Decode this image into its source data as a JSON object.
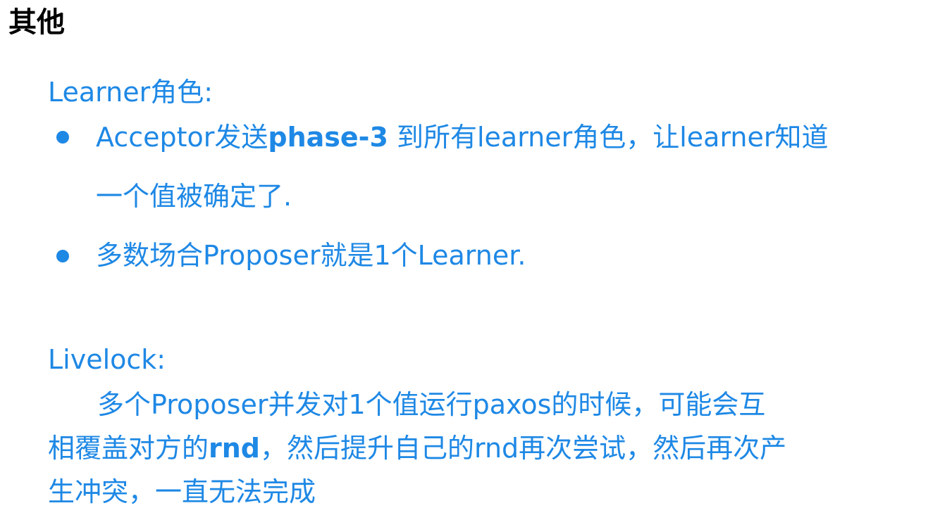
{
  "title": "其他",
  "learner_section": {
    "heading": "Learner角色:",
    "bullet1": {
      "line1_a": "Acceptor发送",
      "line1_b": "phase-3",
      "line1_c": " 到所有learner角色，让learner知道",
      "line2": "一个值被确定了."
    },
    "bullet2": {
      "line1": "多数场合Proposer就是1个Learner."
    }
  },
  "livelock_section": {
    "heading": "Livelock:",
    "line1": "多个Proposer并发对1个值运行paxos的时候，可能会互",
    "line2_a": "相覆盖对方的",
    "line2_b": "rnd",
    "line2_c": "，然后提升自己的rnd再次尝试，然后再次产",
    "line3": "生冲突，一直无法完成"
  },
  "colors": {
    "accent": "#1e88e5",
    "title": "#000000"
  }
}
